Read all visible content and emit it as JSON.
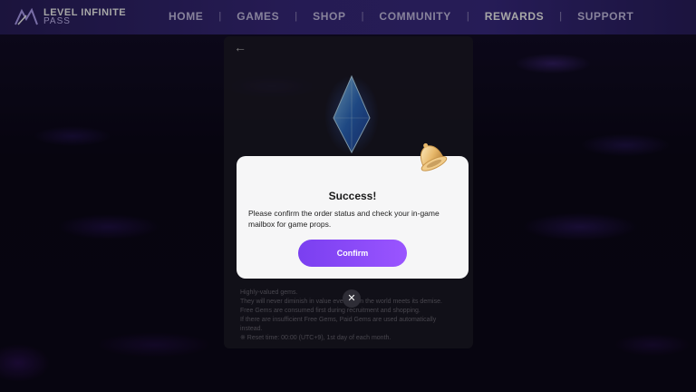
{
  "nav": {
    "logo": {
      "line1": "LEVEL INFINITE",
      "line2": "PASS"
    },
    "items": [
      {
        "label": "HOME",
        "active": false
      },
      {
        "label": "GAMES",
        "active": false
      },
      {
        "label": "SHOP",
        "active": false
      },
      {
        "label": "COMMUNITY",
        "active": false
      },
      {
        "label": "REWARDS",
        "active": true
      },
      {
        "label": "SUPPORT",
        "active": false
      }
    ],
    "separator": "|"
  },
  "panel": {
    "back_icon": "arrow-left-icon",
    "description": [
      "Highly-valued gems.",
      "They will never diminish in value even when the world meets its demise.",
      "Free Gems are consumed first during recruitment and shopping.",
      "If there are insufficient Free Gems, Paid Gems are used automatically",
      "instead.",
      "※ Reset time: 00:00 (UTC+9), 1st day of each month."
    ]
  },
  "modal": {
    "title": "Success!",
    "message": "Please confirm the order status and check your in-game mailbox for game props.",
    "confirm_label": "Confirm",
    "close_symbol": "✕"
  },
  "colors": {
    "accent": "#8a4bf7",
    "nav_bg": "#34277a"
  }
}
